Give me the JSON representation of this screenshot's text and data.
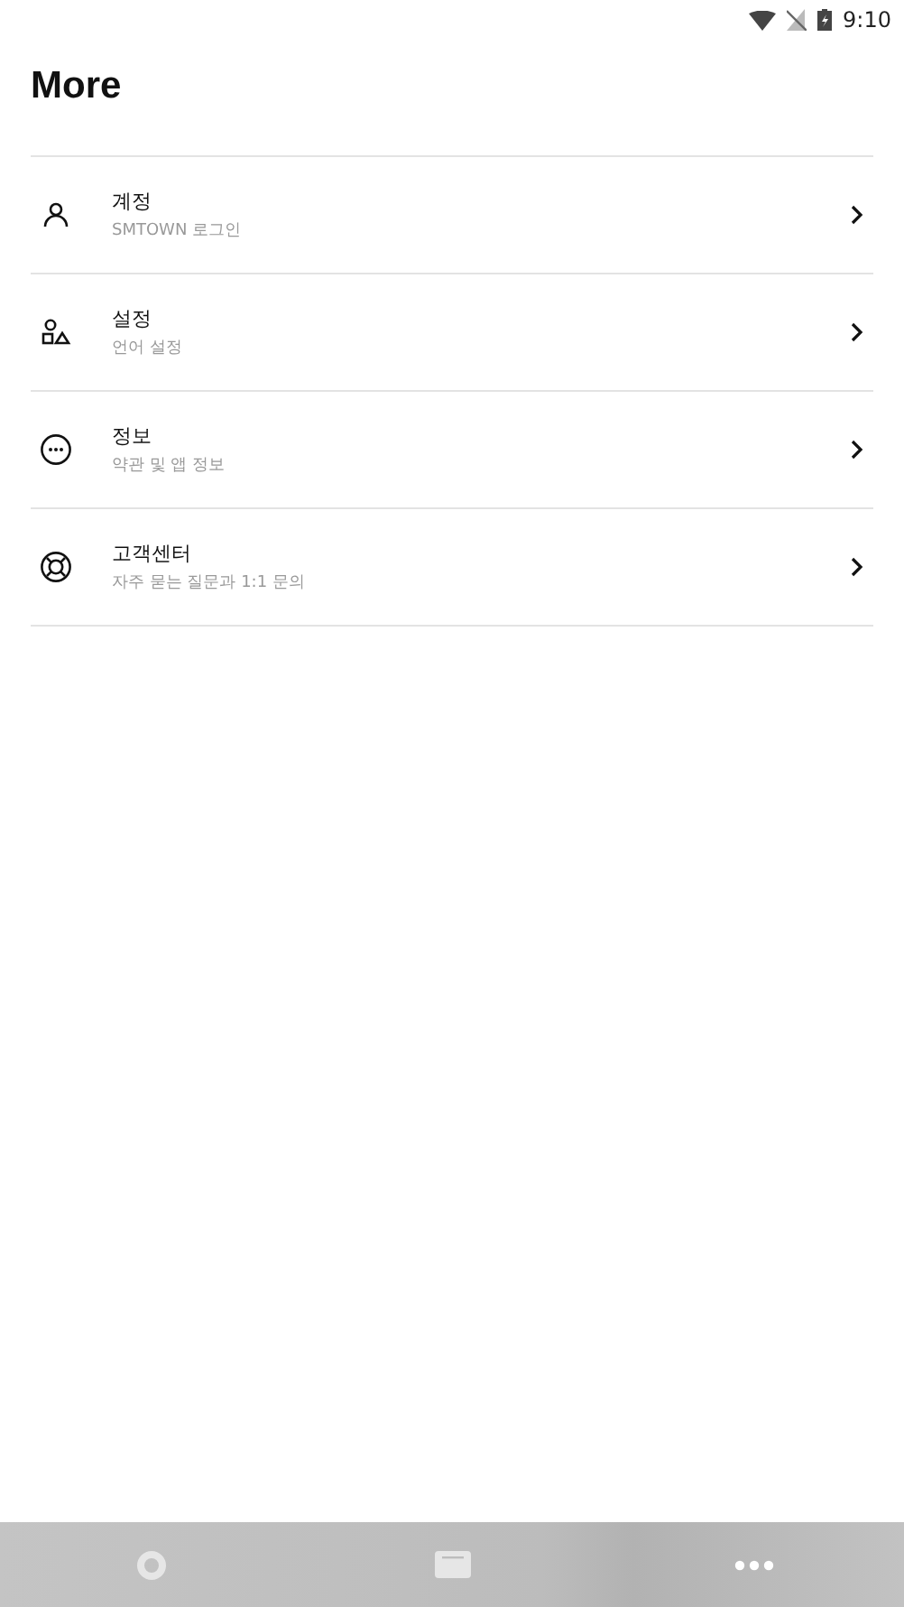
{
  "status_bar": {
    "time": "9:10"
  },
  "title": "More",
  "menu": [
    {
      "kind": "person",
      "label": "계정",
      "sublabel": "SMTOWN 로그인"
    },
    {
      "kind": "shapes",
      "label": "설정",
      "sublabel": "언어 설정"
    },
    {
      "kind": "dots",
      "label": "정보",
      "sublabel": "약관 및 앱 정보"
    },
    {
      "kind": "lifebuoy",
      "label": "고객센터",
      "sublabel": "자주 묻는 질문과 1:1 문의"
    }
  ],
  "bottom_nav": [
    {
      "kind": "circle",
      "selected": false
    },
    {
      "kind": "card",
      "selected": false
    },
    {
      "kind": "more",
      "selected": true
    }
  ]
}
